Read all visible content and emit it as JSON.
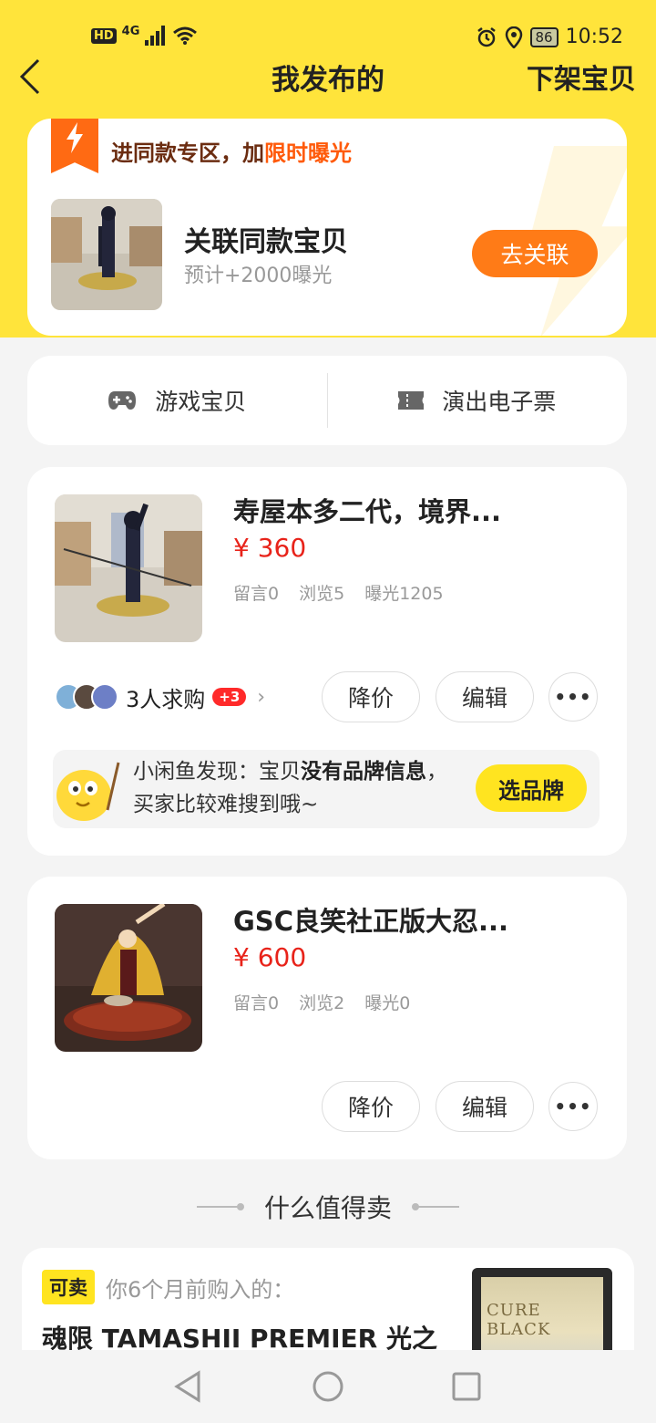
{
  "status_bar": {
    "hd": "HD",
    "signal": "4G",
    "battery": "86",
    "time": "10:52"
  },
  "nav": {
    "title": "我发布的",
    "right_action": "下架宝贝"
  },
  "promo": {
    "headline_prefix": "进同款专区，加",
    "headline_highlight": "限时曝光",
    "title": "关联同款宝贝",
    "subtitle": "预计+2000曝光",
    "button": "去关联"
  },
  "categories": [
    {
      "label": "游戏宝贝",
      "icon": "gamepad-icon"
    },
    {
      "label": "演出电子票",
      "icon": "ticket-icon"
    }
  ],
  "listings": [
    {
      "title": "寿屋本多二代，境界...",
      "price": "¥ 360",
      "stats": [
        "留言0",
        "浏览5",
        "曝光1205"
      ],
      "buyers_text": "3人求购",
      "buyers_badge": "+3",
      "actions": {
        "price_cut": "降价",
        "edit": "编辑",
        "more": "•••"
      },
      "tip": {
        "text_prefix": "小闲鱼发现：宝贝",
        "text_bold": "没有品牌信息",
        "text_suffix": "，买家比较难搜到哦~",
        "button": "选品牌"
      }
    },
    {
      "title": "GSC良笑社正版大忍...",
      "price": "¥ 600",
      "stats": [
        "留言0",
        "浏览2",
        "曝光0"
      ],
      "actions": {
        "price_cut": "降价",
        "edit": "编辑",
        "more": "•••"
      }
    }
  ],
  "section": {
    "title": "什么值得卖"
  },
  "sellable": {
    "tag": "可卖",
    "meta": "你6个月前购入的：",
    "title": "魂限 TAMASHII PREMIER 光之",
    "image_text": "CURE BLACK"
  },
  "colors": {
    "brand_yellow": "#ffe43b",
    "accent_orange": "#ff7b17",
    "price_red": "#e8231a"
  }
}
